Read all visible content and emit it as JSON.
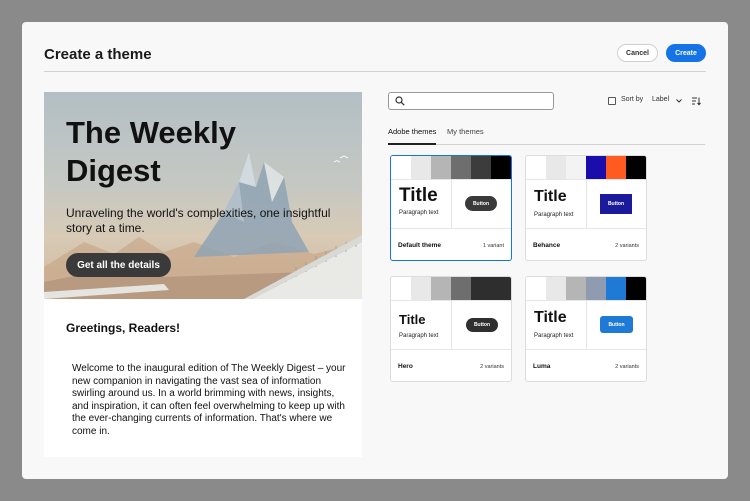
{
  "dialog": {
    "title": "Create a theme",
    "cancel_label": "Cancel",
    "create_label": "Create"
  },
  "preview": {
    "hero_title": "The Weekly Digest",
    "hero_subtitle": "Unraveling the world's complexities, one insightful story at a time.",
    "hero_button": "Get all the details",
    "greeting": "Greetings, Readers!",
    "body": "Welcome to the inaugural edition of The Weekly Digest – your new companion in navigating the vast sea of information swirling around us. In a world brimming with news, insights, and inspiration, it can often feel overwhelming to keep up with the ever-changing currents of information. That's where we come in."
  },
  "search": {
    "placeholder": "",
    "value": "",
    "icon": "search-icon"
  },
  "sort": {
    "label": "Sort by",
    "value": "Label",
    "checked": false
  },
  "tabs": [
    {
      "label": "Adobe themes",
      "active": true
    },
    {
      "label": "My themes",
      "active": false
    }
  ],
  "themes": [
    {
      "name": "Default theme",
      "variants": "1 variant",
      "title": "Title",
      "paragraph": "Paragraph text",
      "button": "Button",
      "swatches": [
        "#ffffff",
        "#e8e8e8",
        "#b5b5b5",
        "#6e6e6e",
        "#3c3c3c",
        "#000000"
      ],
      "button_color": "#3a3a3a",
      "selected": true
    },
    {
      "name": "Behance",
      "variants": "2 variants",
      "title": "Title",
      "paragraph": "Paragraph text",
      "button": "Button",
      "swatches": [
        "#ffffff",
        "#e8e8e8",
        "#f3f3f3",
        "#1a0dab",
        "#ff5a1f",
        "#000000"
      ],
      "button_color": "#1a1a9a",
      "selected": false
    },
    {
      "name": "Hero",
      "variants": "2 variants",
      "title": "Title",
      "paragraph": "Paragraph text",
      "button": "Button",
      "swatches": [
        "#ffffff",
        "#e8e8e8",
        "#b5b5b5",
        "#6e6e6e",
        "#2e2e2e",
        "#2e2e2e"
      ],
      "button_color": "#2f2f2f",
      "selected": false
    },
    {
      "name": "Luma",
      "variants": "2 variants",
      "title": "Title",
      "paragraph": "Paragraph text",
      "button": "Button",
      "swatches": [
        "#ffffff",
        "#e8e8e8",
        "#b5b5b5",
        "#8e9bb0",
        "#1f7ad6",
        "#000000"
      ],
      "button_color": "#1f7ad6",
      "selected": false
    }
  ],
  "colors": {
    "accent": "#1473e6",
    "dialog_bg": "#f8f8f8",
    "backdrop": "#8a8a8a"
  }
}
